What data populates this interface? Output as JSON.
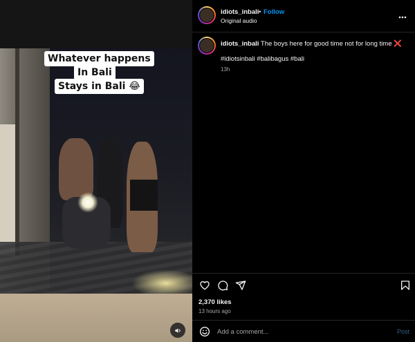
{
  "post": {
    "username": "idiots_inbali",
    "separator": "•",
    "follow_label": "Follow",
    "audio_label": "Original audio",
    "more_icon": "more-horizontal-icon"
  },
  "media": {
    "overlay_lines": [
      "Whatever happens",
      "In Bali",
      "Stays in Bali 😂"
    ],
    "mute_icon": "speaker-icon"
  },
  "caption": {
    "username": "idiots_inbali",
    "text": "The boys here for good time not for long time",
    "emoji": "❌",
    "hashtags": "#idiotsinbali #balibagus #bali",
    "time": "13h"
  },
  "actions": {
    "icons": [
      "heart-icon",
      "comment-icon",
      "share-icon",
      "bookmark-icon"
    ],
    "likes": "2,370 likes",
    "posted": "13 hours ago"
  },
  "comment_bar": {
    "placeholder": "Add a comment...",
    "post_label": "Post"
  },
  "colors": {
    "accent": "#0095f6",
    "background": "#000000",
    "text": "#f5f5f5",
    "muted": "#a8a8a8"
  }
}
